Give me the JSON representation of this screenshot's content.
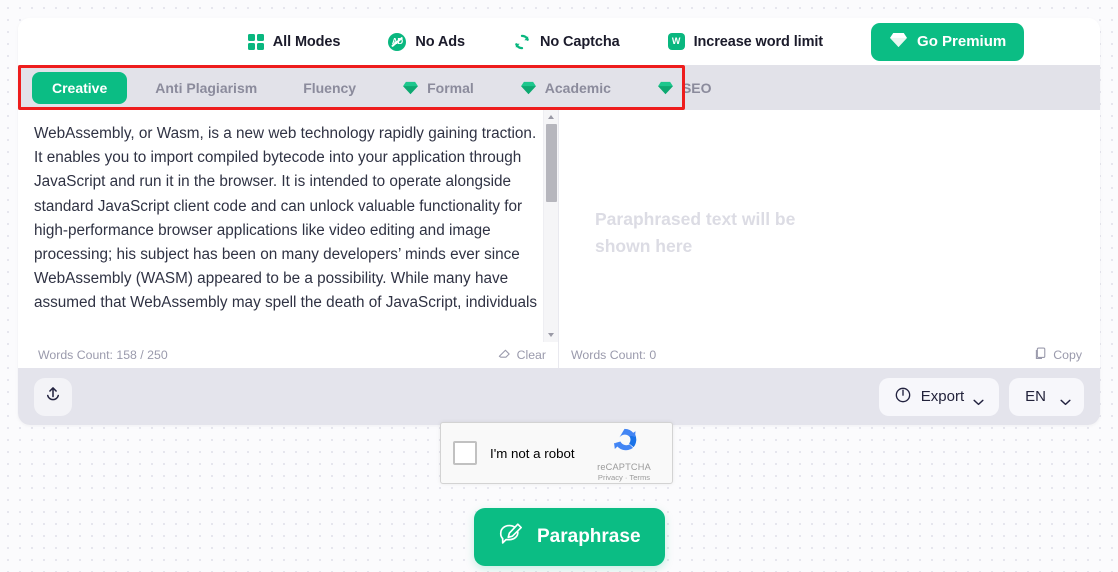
{
  "promo": {
    "items": [
      {
        "icon": "grid-icon",
        "label": "All Modes"
      },
      {
        "icon": "no-ads-icon",
        "label": "No Ads",
        "badge": "AD"
      },
      {
        "icon": "no-captcha-icon",
        "label": "No Captcha"
      },
      {
        "icon": "word-limit-icon",
        "label": "Increase word limit",
        "badge": "W"
      }
    ],
    "premium_label": "Go Premium",
    "premium_icon": "diamond-icon",
    "premium_color": "#0bbd84"
  },
  "tabs": {
    "highlight_color": "#ee1d1d",
    "items": [
      {
        "label": "Creative",
        "active": true,
        "premium": false
      },
      {
        "label": "Anti Plagiarism",
        "active": false,
        "premium": false
      },
      {
        "label": "Fluency",
        "active": false,
        "premium": false
      },
      {
        "label": "Formal",
        "active": false,
        "premium": true
      },
      {
        "label": "Academic",
        "active": false,
        "premium": true
      },
      {
        "label": "SEO",
        "active": false,
        "premium": true
      }
    ]
  },
  "editor": {
    "input_text": "WebAssembly, or Wasm, is a new web technology rapidly gaining traction. It enables you to import compiled bytecode into your application through JavaScript and run it in the browser. It is intended to operate alongside standard JavaScript client code and can unlock valuable functionality for high-performance browser applications like video editing and image processing; his subject has been on many developers’ minds ever since WebAssembly (WASM) appeared to be a possibility. While many have assumed that WebAssembly may spell the death of JavaScript, individuals",
    "output_placeholder": "Paraphrased text will be shown here",
    "left_words_count": "Words Count: 158 / 250",
    "right_words_count": "Words Count: 0",
    "clear_label": "Clear",
    "copy_label": "Copy"
  },
  "toolbar": {
    "upload_icon": "upload-icon",
    "export_label": "Export",
    "export_icon": "power-icon",
    "language_label": "EN"
  },
  "captcha": {
    "checkbox_label": "I'm not a robot",
    "brand": "reCAPTCHA",
    "links": "Privacy · Terms"
  },
  "action": {
    "paraphrase_label": "Paraphrase",
    "paraphrase_icon": "edit-message-icon"
  }
}
